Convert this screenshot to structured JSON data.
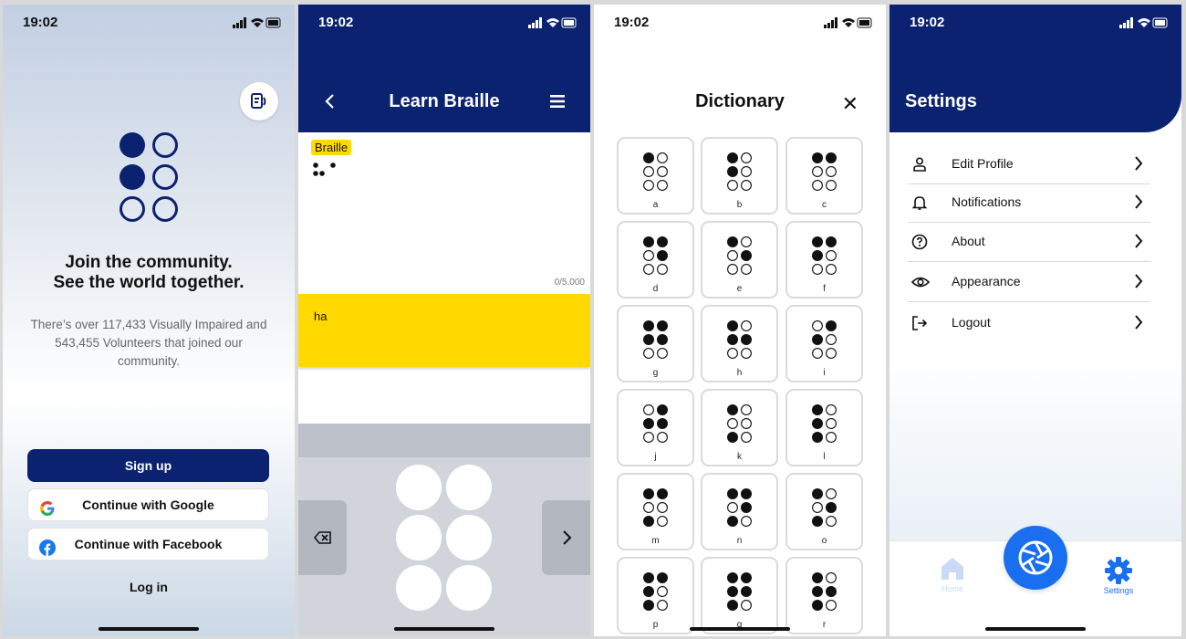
{
  "status": {
    "time": "19:02"
  },
  "onboarding": {
    "headline_line1": "Join the community.",
    "headline_line2": "See the world together.",
    "subtext": "There’s over 117,433 Visually Impaired and 543,455 Volunteers that joined our community.",
    "signup_label": "Sign up",
    "google_label": "Continue with Google",
    "facebook_label": "Continue with Facebook",
    "login_label": "Log in"
  },
  "learn": {
    "title": "Learn Braille",
    "chip_label": "Braille",
    "counter": "0/5,000",
    "output_text": "ha"
  },
  "dictionary": {
    "title": "Dictionary",
    "close_symbol": "✕",
    "letters": [
      {
        "label": "a",
        "dots": [
          1,
          0,
          0,
          0,
          0,
          0
        ]
      },
      {
        "label": "b",
        "dots": [
          1,
          0,
          1,
          0,
          0,
          0
        ]
      },
      {
        "label": "c",
        "dots": [
          1,
          1,
          0,
          0,
          0,
          0
        ]
      },
      {
        "label": "d",
        "dots": [
          1,
          1,
          0,
          1,
          0,
          0
        ]
      },
      {
        "label": "e",
        "dots": [
          1,
          0,
          0,
          1,
          0,
          0
        ]
      },
      {
        "label": "f",
        "dots": [
          1,
          1,
          1,
          0,
          0,
          0
        ]
      },
      {
        "label": "g",
        "dots": [
          1,
          1,
          1,
          1,
          0,
          0
        ]
      },
      {
        "label": "h",
        "dots": [
          1,
          0,
          1,
          1,
          0,
          0
        ]
      },
      {
        "label": "i",
        "dots": [
          0,
          1,
          1,
          0,
          0,
          0
        ]
      },
      {
        "label": "j",
        "dots": [
          0,
          1,
          1,
          1,
          0,
          0
        ]
      },
      {
        "label": "k",
        "dots": [
          1,
          0,
          0,
          0,
          1,
          0
        ]
      },
      {
        "label": "l",
        "dots": [
          1,
          0,
          1,
          0,
          1,
          0
        ]
      },
      {
        "label": "m",
        "dots": [
          1,
          1,
          0,
          0,
          1,
          0
        ]
      },
      {
        "label": "n",
        "dots": [
          1,
          1,
          0,
          1,
          1,
          0
        ]
      },
      {
        "label": "o",
        "dots": [
          1,
          0,
          0,
          1,
          1,
          0
        ]
      },
      {
        "label": "p",
        "dots": [
          1,
          1,
          1,
          0,
          1,
          0
        ]
      },
      {
        "label": "q",
        "dots": [
          1,
          1,
          1,
          1,
          1,
          0
        ]
      },
      {
        "label": "r",
        "dots": [
          1,
          0,
          1,
          1,
          1,
          0
        ]
      }
    ]
  },
  "settings": {
    "title": "Settings",
    "items": [
      {
        "label": "Edit Profile",
        "icon": "user-icon"
      },
      {
        "label": "Notifications",
        "icon": "bell-icon"
      },
      {
        "label": "About",
        "icon": "help-circle-icon"
      },
      {
        "label": "Appearance",
        "icon": "eye-icon"
      },
      {
        "label": "Logout",
        "icon": "logout-icon"
      }
    ],
    "tab_home": "Home",
    "tab_settings": "Settings"
  },
  "colors": {
    "navy": "#0b2270",
    "yellow": "#ffd900",
    "blue": "#1a6ff0"
  }
}
